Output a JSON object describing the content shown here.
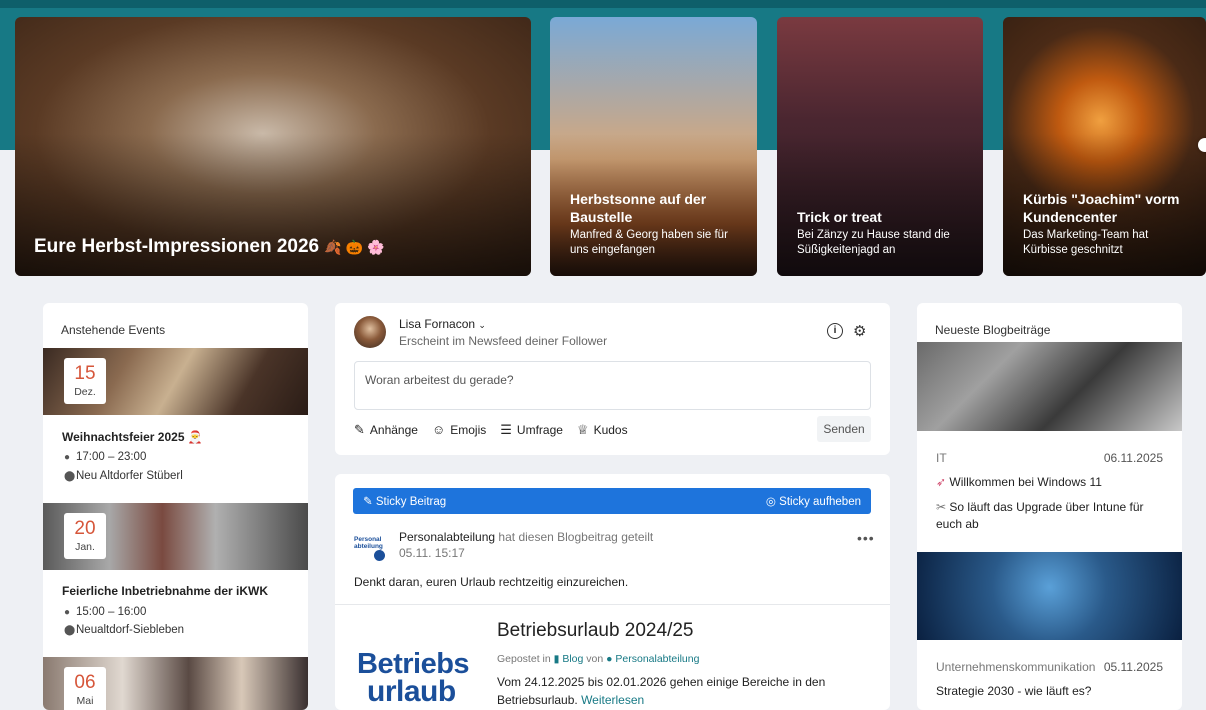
{
  "hero": [
    {
      "title": "Eure Herbst-Impressionen 2026",
      "subtitle": "",
      "emoji": "🍂 🎃 🌸"
    },
    {
      "title": "Herbstsonne auf der Baustelle",
      "subtitle": "Manfred & Georg haben sie für uns eingefangen"
    },
    {
      "title": "Trick or treat",
      "subtitle": "Bei Zänzy zu Hause stand die Süßigkeitenjagd an"
    },
    {
      "title": "Kürbis \"Joachim\" vorm Kundencenter",
      "subtitle": "Das Marketing-Team hat Kürbisse geschnitzt"
    }
  ],
  "events": {
    "title": "Anstehende Events",
    "items": [
      {
        "day": "15",
        "month": "Dez.",
        "title": "Weihnachtsfeier 2025 🎅",
        "time": "17:00 – 23:00",
        "location": "Neu Altdorfer Stüberl"
      },
      {
        "day": "20",
        "month": "Jan.",
        "title": "Feierliche Inbetriebnahme der iKWK",
        "time": "15:00 – 16:00",
        "location": "Neualtdorf-Siebleben"
      },
      {
        "day": "06",
        "month": "Mai",
        "title": "",
        "time": "",
        "location": ""
      }
    ]
  },
  "composer": {
    "user_name": "Lisa Fornacon",
    "visibility": "Erscheint im Newsfeed deiner Follower",
    "placeholder": "Woran arbeitest du gerade?",
    "tools": [
      "Anhänge",
      "Emojis",
      "Umfrage",
      "Kudos"
    ],
    "send_label": "Senden"
  },
  "post": {
    "sticky_label": "Sticky Beitrag",
    "unsticky_label": "Sticky aufheben",
    "author": "Personalabteilung",
    "action": "hat diesen Blogbeitrag",
    "action2": "geteilt",
    "time": "05.11. 15:17",
    "text": "Denkt daran, euren Urlaub rechtzeitig einzureichen.",
    "logo_line1": "Betriebs",
    "logo_line2": "urlaub",
    "blog_title": "Betriebsurlaub 2024/25",
    "meta_prefix": "Gepostet in",
    "meta_blog": "Blog",
    "meta_von": "von",
    "meta_author": "Personalabteilung",
    "excerpt": "Vom 24.12.2025 bis 02.01.2026 gehen einige Bereiche in den Betriebsurlaub.",
    "read_more": "Weiterlesen"
  },
  "blog": {
    "title": "Neueste Blogbeiträge",
    "items": [
      {
        "category": "IT",
        "date": "06.11.2025",
        "title": "Willkommen bei Windows 11",
        "subtitle": "So läuft das Upgrade über Intune für euch ab"
      },
      {
        "category": "Unternehmenskommunikation",
        "date": "05.11.2025",
        "title": "Strategie 2030 - wie läuft es?",
        "subtitle": ""
      }
    ]
  }
}
